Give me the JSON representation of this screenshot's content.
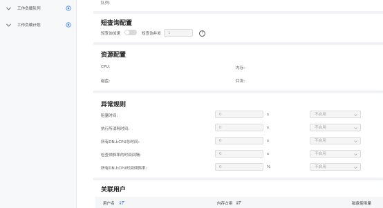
{
  "sidebar": {
    "items": [
      {
        "label": "工作负载队列"
      },
      {
        "label": "工作负载计划"
      }
    ]
  },
  "top": {
    "queue_label": "队列:"
  },
  "short_query": {
    "title": "短查询配置",
    "accel_label": "短查询加速",
    "concurrency_label": "短查询并发",
    "concurrency_value": "1",
    "accel_enabled": false
  },
  "resource": {
    "title": "资源配置",
    "cpu_label": "CPU:",
    "memory_label": "内存:",
    "disk_label": "磁盘:",
    "concurrency_label": "并发:"
  },
  "rules": {
    "title": "异常规则",
    "rows": [
      {
        "label": "阻塞时间:",
        "value": "0",
        "unit": "s",
        "action": "不启用"
      },
      {
        "label": "执行所消耗时间:",
        "value": "0",
        "unit": "s",
        "action": "不启用"
      },
      {
        "label": "所有DN上CPU总时间:",
        "value": "0",
        "unit": "s",
        "action": "不启用"
      },
      {
        "label": "检查倾斜率的时间间隔:",
        "value": "0",
        "unit": "s",
        "action": "不启用"
      },
      {
        "label": "所有DN上CPU时间倾斜率:",
        "value": "0",
        "unit": "%",
        "action": "不启用"
      }
    ]
  },
  "users": {
    "title": "关联用户",
    "columns": [
      "用户名",
      "内存占用",
      "磁盘使用量"
    ]
  },
  "colors": {
    "accent": "#2f7be8",
    "sidebar_bg": "#f7f8fa",
    "divider": "#f0f2f5"
  }
}
